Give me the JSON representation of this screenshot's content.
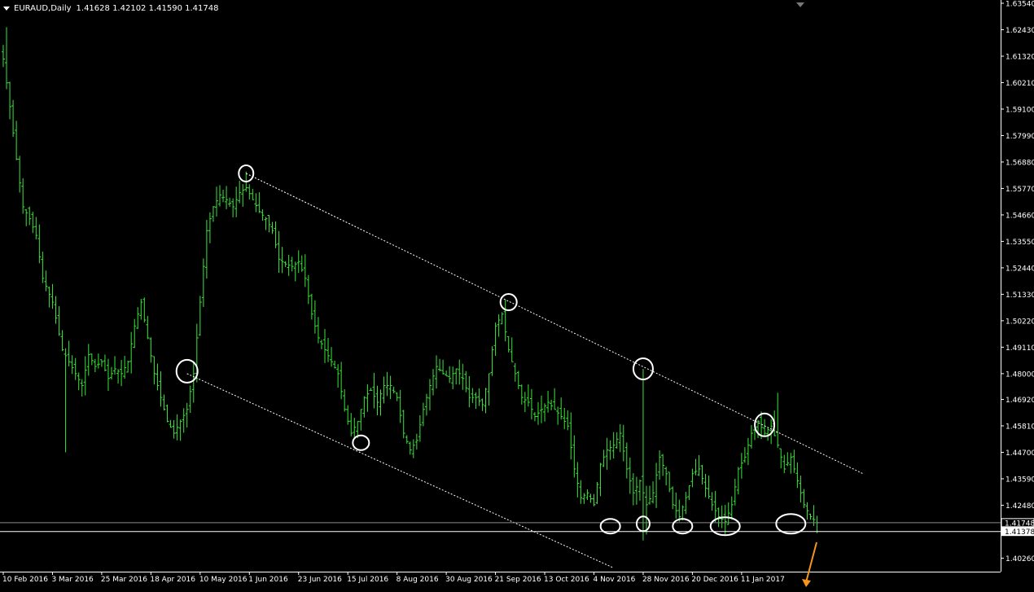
{
  "header": {
    "symbol": "EURAUD,Daily",
    "ohlc": "1.41628 1.42102 1.41590 1.41748"
  },
  "price_labels": {
    "current": "1.41748",
    "support": "1.41378"
  },
  "colors": {
    "background": "#000000",
    "candles": "#39e639",
    "axis": "#ffffff",
    "annotations": "#ffffff",
    "arrow": "#f7941d"
  },
  "chart_data": {
    "type": "bar",
    "title": "EURAUD,Daily",
    "subtitle": "1.41628 1.42102 1.41590 1.41748",
    "ylim": [
      1.3983,
      1.6354
    ],
    "y_ticks": [
      "1.63540",
      "1.62430",
      "1.61320",
      "1.60210",
      "1.59100",
      "1.57990",
      "1.56880",
      "1.55770",
      "1.54660",
      "1.53550",
      "1.52440",
      "1.51330",
      "1.50220",
      "1.49110",
      "1.48000",
      "1.46920",
      "1.45810",
      "1.44700",
      "1.43590",
      "1.42480",
      "1.41378",
      "1.40260"
    ],
    "x_ticks": [
      "10 Feb 2016",
      "3 Mar 2016",
      "25 Mar 2016",
      "18 Apr 2016",
      "10 May 2016",
      "1 Jun 2016",
      "23 Jun 2016",
      "15 Jul 2016",
      "8 Aug 2016",
      "30 Aug 2016",
      "21 Sep 2016",
      "13 Oct 2016",
      "4 Nov 2016",
      "28 Nov 2016",
      "20 Dec 2016",
      "11 Jan 2017"
    ],
    "grid": false,
    "series": [
      {
        "close_path": [
          [
            0,
            1.612
          ],
          [
            2,
            1.592
          ],
          [
            4,
            1.57
          ],
          [
            6,
            1.55
          ],
          [
            8,
            1.545
          ],
          [
            10,
            1.538
          ],
          [
            12,
            1.52
          ],
          [
            15,
            1.51
          ],
          [
            18,
            1.49
          ],
          [
            20,
            1.485
          ],
          [
            22,
            1.48
          ],
          [
            24,
            1.475
          ],
          [
            26,
            1.488
          ],
          [
            28,
            1.483
          ],
          [
            30,
            1.485
          ],
          [
            32,
            1.478
          ],
          [
            34,
            1.482
          ],
          [
            36,
            1.48
          ],
          [
            38,
            1.485
          ],
          [
            40,
            1.5
          ],
          [
            42,
            1.51
          ],
          [
            44,
            1.495
          ],
          [
            46,
            1.48
          ],
          [
            48,
            1.47
          ],
          [
            50,
            1.46
          ],
          [
            52,
            1.455
          ],
          [
            54,
            1.46
          ],
          [
            56,
            1.465
          ],
          [
            58,
            1.48
          ],
          [
            60,
            1.51
          ],
          [
            62,
            1.54
          ],
          [
            64,
            1.55
          ],
          [
            66,
            1.555
          ],
          [
            68,
            1.553
          ],
          [
            70,
            1.55
          ],
          [
            72,
            1.556
          ],
          [
            74,
            1.558
          ],
          [
            76,
            1.553
          ],
          [
            78,
            1.548
          ],
          [
            80,
            1.545
          ],
          [
            82,
            1.54
          ],
          [
            84,
            1.528
          ],
          [
            86,
            1.526
          ],
          [
            88,
            1.525
          ],
          [
            90,
            1.527
          ],
          [
            92,
            1.52
          ],
          [
            94,
            1.505
          ],
          [
            96,
            1.495
          ],
          [
            98,
            1.49
          ],
          [
            100,
            1.485
          ],
          [
            102,
            1.48
          ],
          [
            104,
            1.465
          ],
          [
            106,
            1.455
          ],
          [
            108,
            1.46
          ],
          [
            110,
            1.47
          ],
          [
            112,
            1.473
          ],
          [
            114,
            1.468
          ],
          [
            116,
            1.475
          ],
          [
            118,
            1.475
          ],
          [
            120,
            1.47
          ],
          [
            122,
            1.455
          ],
          [
            124,
            1.448
          ],
          [
            126,
            1.452
          ],
          [
            128,
            1.465
          ],
          [
            130,
            1.475
          ],
          [
            132,
            1.483
          ],
          [
            134,
            1.48
          ],
          [
            136,
            1.478
          ],
          [
            138,
            1.482
          ],
          [
            140,
            1.478
          ],
          [
            142,
            1.47
          ],
          [
            144,
            1.47
          ],
          [
            146,
            1.467
          ],
          [
            148,
            1.48
          ],
          [
            150,
            1.5
          ],
          [
            152,
            1.505
          ],
          [
            154,
            1.49
          ],
          [
            156,
            1.48
          ],
          [
            158,
            1.47
          ],
          [
            160,
            1.468
          ],
          [
            162,
            1.462
          ],
          [
            164,
            1.465
          ],
          [
            166,
            1.468
          ],
          [
            168,
            1.465
          ],
          [
            170,
            1.462
          ],
          [
            172,
            1.458
          ],
          [
            174,
            1.44
          ],
          [
            176,
            1.428
          ],
          [
            178,
            1.43
          ],
          [
            180,
            1.425
          ],
          [
            182,
            1.442
          ],
          [
            184,
            1.448
          ],
          [
            186,
            1.45
          ],
          [
            188,
            1.455
          ],
          [
            190,
            1.44
          ],
          [
            192,
            1.43
          ],
          [
            194,
            1.435
          ],
          [
            196,
            1.425
          ],
          [
            198,
            1.43
          ],
          [
            200,
            1.445
          ],
          [
            202,
            1.438
          ],
          [
            204,
            1.425
          ],
          [
            206,
            1.42
          ],
          [
            208,
            1.428
          ],
          [
            210,
            1.438
          ],
          [
            212,
            1.44
          ],
          [
            214,
            1.432
          ],
          [
            216,
            1.425
          ],
          [
            218,
            1.42
          ],
          [
            220,
            1.418
          ],
          [
            222,
            1.425
          ],
          [
            224,
            1.44
          ],
          [
            226,
            1.445
          ],
          [
            228,
            1.455
          ],
          [
            230,
            1.46
          ],
          [
            232,
            1.455
          ],
          [
            234,
            1.458
          ],
          [
            236,
            1.45
          ],
          [
            238,
            1.44
          ],
          [
            240,
            1.445
          ],
          [
            242,
            1.435
          ],
          [
            244,
            1.425
          ],
          [
            246,
            1.42
          ],
          [
            248,
            1.4175
          ]
        ]
      }
    ],
    "annotations": {
      "upper_trendline": [
        [
          74,
          1.564
        ],
        [
          262,
          1.438
        ]
      ],
      "lower_trendline": [
        [
          56,
          1.48
        ],
        [
          186,
          1.3985
        ]
      ],
      "support_line": 1.41378,
      "current_price_line": 1.41748,
      "circled_points": [
        [
          74,
          1.564
        ],
        [
          154,
          1.51
        ],
        [
          195,
          1.482
        ],
        [
          232,
          1.4585
        ],
        [
          56,
          1.481
        ],
        [
          109,
          1.451
        ],
        [
          185,
          1.416
        ],
        [
          195,
          1.417
        ],
        [
          207,
          1.416
        ],
        [
          220,
          1.416
        ],
        [
          240,
          1.417
        ]
      ]
    }
  }
}
